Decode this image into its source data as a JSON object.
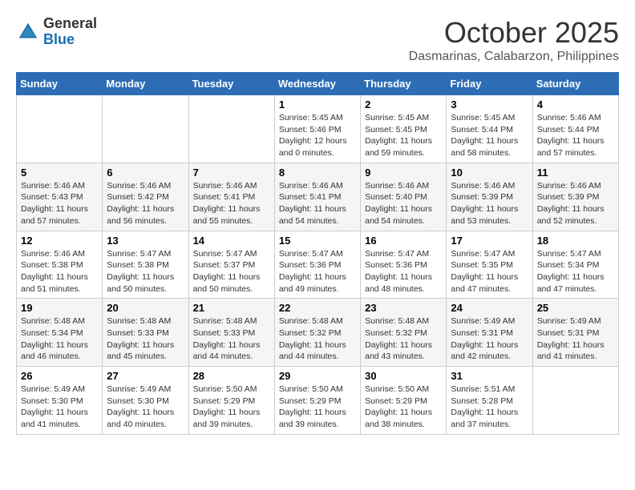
{
  "header": {
    "logo": {
      "general": "General",
      "blue": "Blue"
    },
    "title": "October 2025",
    "location": "Dasmarinas, Calabarzon, Philippines"
  },
  "weekdays": [
    "Sunday",
    "Monday",
    "Tuesday",
    "Wednesday",
    "Thursday",
    "Friday",
    "Saturday"
  ],
  "weeks": [
    [
      {
        "day": "",
        "info": ""
      },
      {
        "day": "",
        "info": ""
      },
      {
        "day": "",
        "info": ""
      },
      {
        "day": "1",
        "info": "Sunrise: 5:45 AM\nSunset: 5:46 PM\nDaylight: 12 hours\nand 0 minutes."
      },
      {
        "day": "2",
        "info": "Sunrise: 5:45 AM\nSunset: 5:45 PM\nDaylight: 11 hours\nand 59 minutes."
      },
      {
        "day": "3",
        "info": "Sunrise: 5:45 AM\nSunset: 5:44 PM\nDaylight: 11 hours\nand 58 minutes."
      },
      {
        "day": "4",
        "info": "Sunrise: 5:46 AM\nSunset: 5:44 PM\nDaylight: 11 hours\nand 57 minutes."
      }
    ],
    [
      {
        "day": "5",
        "info": "Sunrise: 5:46 AM\nSunset: 5:43 PM\nDaylight: 11 hours\nand 57 minutes."
      },
      {
        "day": "6",
        "info": "Sunrise: 5:46 AM\nSunset: 5:42 PM\nDaylight: 11 hours\nand 56 minutes."
      },
      {
        "day": "7",
        "info": "Sunrise: 5:46 AM\nSunset: 5:41 PM\nDaylight: 11 hours\nand 55 minutes."
      },
      {
        "day": "8",
        "info": "Sunrise: 5:46 AM\nSunset: 5:41 PM\nDaylight: 11 hours\nand 54 minutes."
      },
      {
        "day": "9",
        "info": "Sunrise: 5:46 AM\nSunset: 5:40 PM\nDaylight: 11 hours\nand 54 minutes."
      },
      {
        "day": "10",
        "info": "Sunrise: 5:46 AM\nSunset: 5:39 PM\nDaylight: 11 hours\nand 53 minutes."
      },
      {
        "day": "11",
        "info": "Sunrise: 5:46 AM\nSunset: 5:39 PM\nDaylight: 11 hours\nand 52 minutes."
      }
    ],
    [
      {
        "day": "12",
        "info": "Sunrise: 5:46 AM\nSunset: 5:38 PM\nDaylight: 11 hours\nand 51 minutes."
      },
      {
        "day": "13",
        "info": "Sunrise: 5:47 AM\nSunset: 5:38 PM\nDaylight: 11 hours\nand 50 minutes."
      },
      {
        "day": "14",
        "info": "Sunrise: 5:47 AM\nSunset: 5:37 PM\nDaylight: 11 hours\nand 50 minutes."
      },
      {
        "day": "15",
        "info": "Sunrise: 5:47 AM\nSunset: 5:36 PM\nDaylight: 11 hours\nand 49 minutes."
      },
      {
        "day": "16",
        "info": "Sunrise: 5:47 AM\nSunset: 5:36 PM\nDaylight: 11 hours\nand 48 minutes."
      },
      {
        "day": "17",
        "info": "Sunrise: 5:47 AM\nSunset: 5:35 PM\nDaylight: 11 hours\nand 47 minutes."
      },
      {
        "day": "18",
        "info": "Sunrise: 5:47 AM\nSunset: 5:34 PM\nDaylight: 11 hours\nand 47 minutes."
      }
    ],
    [
      {
        "day": "19",
        "info": "Sunrise: 5:48 AM\nSunset: 5:34 PM\nDaylight: 11 hours\nand 46 minutes."
      },
      {
        "day": "20",
        "info": "Sunrise: 5:48 AM\nSunset: 5:33 PM\nDaylight: 11 hours\nand 45 minutes."
      },
      {
        "day": "21",
        "info": "Sunrise: 5:48 AM\nSunset: 5:33 PM\nDaylight: 11 hours\nand 44 minutes."
      },
      {
        "day": "22",
        "info": "Sunrise: 5:48 AM\nSunset: 5:32 PM\nDaylight: 11 hours\nand 44 minutes."
      },
      {
        "day": "23",
        "info": "Sunrise: 5:48 AM\nSunset: 5:32 PM\nDaylight: 11 hours\nand 43 minutes."
      },
      {
        "day": "24",
        "info": "Sunrise: 5:49 AM\nSunset: 5:31 PM\nDaylight: 11 hours\nand 42 minutes."
      },
      {
        "day": "25",
        "info": "Sunrise: 5:49 AM\nSunset: 5:31 PM\nDaylight: 11 hours\nand 41 minutes."
      }
    ],
    [
      {
        "day": "26",
        "info": "Sunrise: 5:49 AM\nSunset: 5:30 PM\nDaylight: 11 hours\nand 41 minutes."
      },
      {
        "day": "27",
        "info": "Sunrise: 5:49 AM\nSunset: 5:30 PM\nDaylight: 11 hours\nand 40 minutes."
      },
      {
        "day": "28",
        "info": "Sunrise: 5:50 AM\nSunset: 5:29 PM\nDaylight: 11 hours\nand 39 minutes."
      },
      {
        "day": "29",
        "info": "Sunrise: 5:50 AM\nSunset: 5:29 PM\nDaylight: 11 hours\nand 39 minutes."
      },
      {
        "day": "30",
        "info": "Sunrise: 5:50 AM\nSunset: 5:29 PM\nDaylight: 11 hours\nand 38 minutes."
      },
      {
        "day": "31",
        "info": "Sunrise: 5:51 AM\nSunset: 5:28 PM\nDaylight: 11 hours\nand 37 minutes."
      },
      {
        "day": "",
        "info": ""
      }
    ]
  ]
}
